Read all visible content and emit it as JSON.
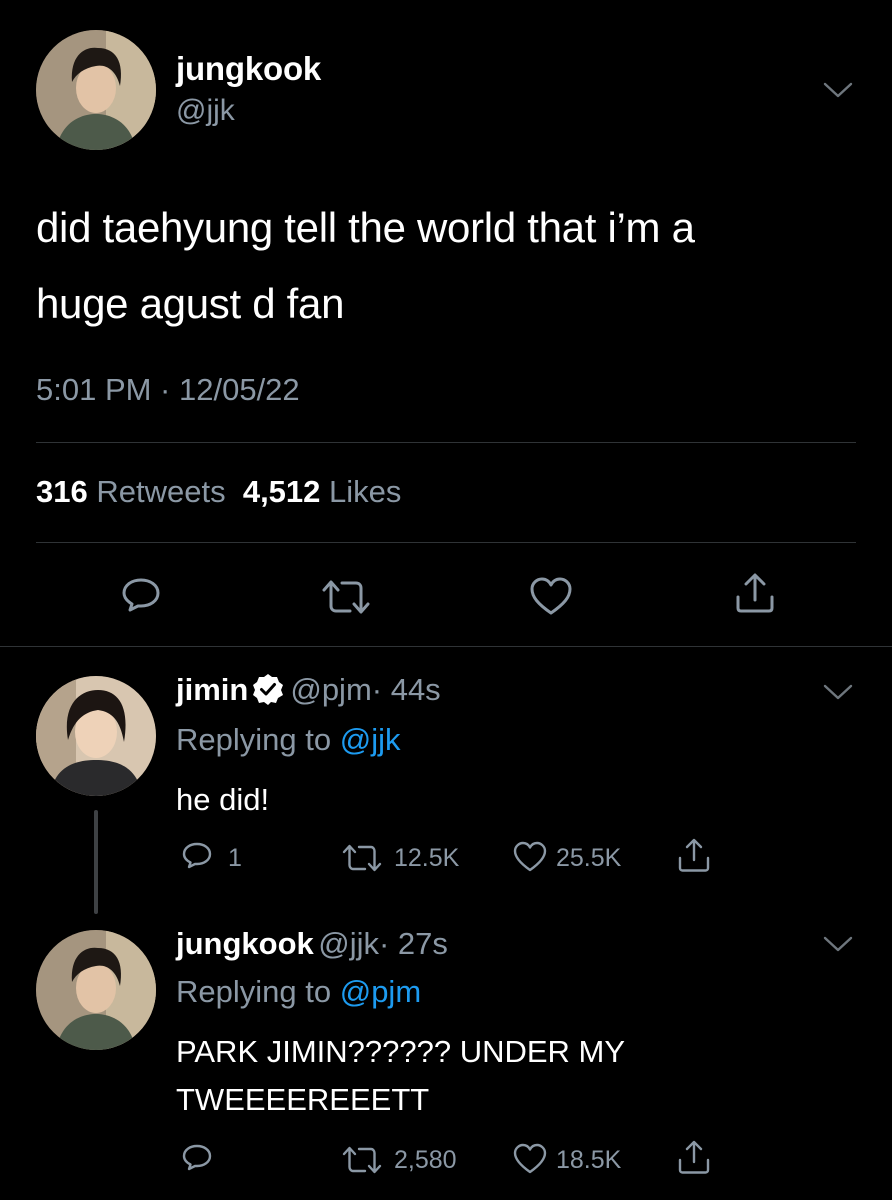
{
  "main_tweet": {
    "display_name": "jungkook",
    "handle": "@jjk",
    "text_line1": "did taehyung tell the world that i’m a",
    "text_line2": "huge agust d fan",
    "timestamp": "5:01 PM · 12/05/22",
    "retweets_count": "316",
    "retweets_label": "Retweets",
    "likes_count": "4,512",
    "likes_label": "Likes",
    "icons": {
      "avatar": "profile-photo",
      "menu": "chevron-down-icon",
      "reply": "reply-icon",
      "retweet": "retweet-icon",
      "like": "heart-icon",
      "share": "share-icon"
    }
  },
  "replies": [
    {
      "display_name": "jimin",
      "verified": true,
      "handle": "@pjm",
      "time": "· 44s",
      "replying_to_label": "Replying to",
      "replying_to_handle": "@jjk",
      "text_line1": "he did!",
      "reply_count": "1",
      "retweet_count": "12.5K",
      "like_count": "25.5K"
    },
    {
      "display_name": "jungkook",
      "verified": false,
      "handle": "@jjk",
      "time": "· 27s",
      "replying_to_label": "Replying to",
      "replying_to_handle": "@pjm",
      "text_line1": "PARK JIMIN?????? UNDER MY",
      "text_line2": "TWEEEEREEETT",
      "reply_count": "",
      "retweet_count": "2,580",
      "like_count": "18.5K"
    }
  ],
  "colors": {
    "background": "#000000",
    "primary_text": "#ffffff",
    "secondary_text": "#8b98a5",
    "accent": "#1d9bf0",
    "divider": "#2f3336"
  }
}
